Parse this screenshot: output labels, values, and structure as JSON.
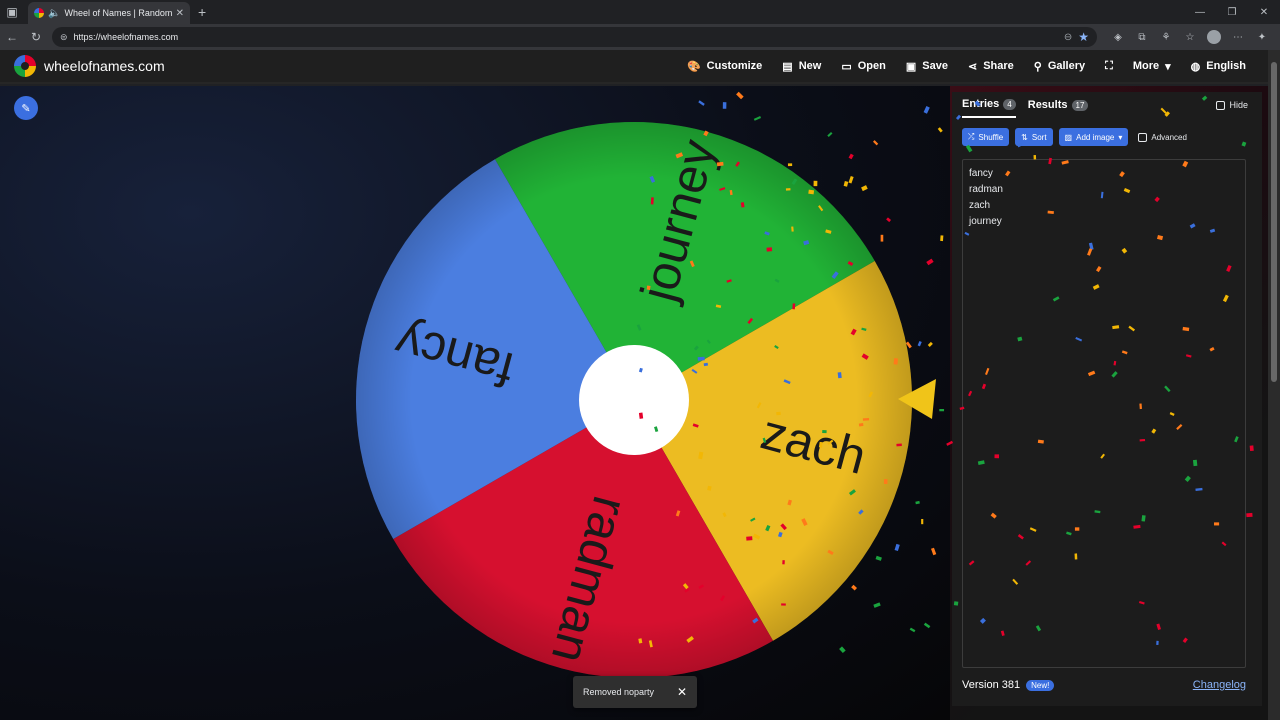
{
  "browser": {
    "tab_title": "Wheel of Names | Random n",
    "url": "https://wheelofnames.com"
  },
  "header": {
    "brand": "wheelofnames.com",
    "menu": [
      {
        "label": "Customize",
        "icon": "palette-icon"
      },
      {
        "label": "New",
        "icon": "file-icon"
      },
      {
        "label": "Open",
        "icon": "folder-icon"
      },
      {
        "label": "Save",
        "icon": "save-icon"
      },
      {
        "label": "Share",
        "icon": "share-icon"
      },
      {
        "label": "Gallery",
        "icon": "search-icon"
      },
      {
        "label": "",
        "icon": "fullscreen-icon"
      },
      {
        "label": "More",
        "icon": "chevron-down-icon"
      },
      {
        "label": "English",
        "icon": "globe-icon"
      }
    ]
  },
  "wheel": {
    "segments": [
      {
        "label": "journey",
        "color": "#21b336"
      },
      {
        "label": "zach",
        "color": "#ecbc22"
      },
      {
        "label": "radman",
        "color": "#d6102f"
      },
      {
        "label": "fancy",
        "color": "#4b7ee0"
      }
    ],
    "pointer_color": "#f0c419"
  },
  "panel": {
    "tabs": [
      {
        "label": "Entries",
        "count": "4"
      },
      {
        "label": "Results",
        "count": "17"
      }
    ],
    "hide_label": "Hide",
    "tools": {
      "shuffle": "Shuffle",
      "sort": "Sort",
      "add_image": "Add image",
      "advanced": "Advanced"
    },
    "entries": [
      "fancy",
      "radman",
      "zach",
      "journey"
    ],
    "version": "Version 381",
    "new_badge": "New!",
    "changelog": "Changelog"
  },
  "toast": {
    "message": "Removed noparty"
  }
}
